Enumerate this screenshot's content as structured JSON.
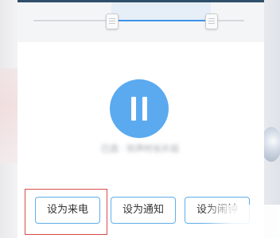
{
  "slider": {
    "start_fraction": 0.37,
    "end_fraction": 0.84
  },
  "player": {
    "state_icon": "pause-icon",
    "subtitle": "已选 · 铃声时长片段"
  },
  "actions": [
    {
      "label": "设为来电",
      "highlighted": true
    },
    {
      "label": "设为通知",
      "highlighted": false
    },
    {
      "label": "设为闹钟",
      "highlighted": false
    }
  ],
  "colors": {
    "accent": "#5baaf0",
    "slider_fill": "#3d93e8",
    "highlight": "#d94b4b"
  }
}
